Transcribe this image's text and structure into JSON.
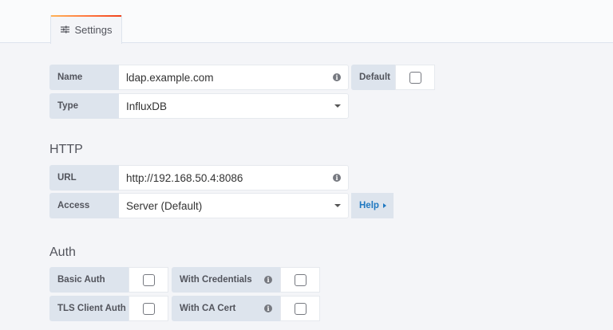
{
  "tabs": [
    {
      "label": "Settings",
      "icon": "sliders-icon",
      "active": true
    }
  ],
  "name": {
    "label": "Name",
    "value": "ldap.example.com"
  },
  "default": {
    "label": "Default",
    "checked": false
  },
  "type": {
    "label": "Type",
    "value": "InfluxDB"
  },
  "http": {
    "heading": "HTTP",
    "url": {
      "label": "URL",
      "value": "http://192.168.50.4:8086"
    },
    "access": {
      "label": "Access",
      "value": "Server (Default)"
    },
    "help_label": "Help"
  },
  "auth": {
    "heading": "Auth",
    "basic_auth": {
      "label": "Basic Auth",
      "checked": false
    },
    "with_credentials": {
      "label": "With Credentials",
      "checked": false
    },
    "tls_client_auth": {
      "label": "TLS Client Auth",
      "checked": false
    },
    "with_ca_cert": {
      "label": "With CA Cert",
      "checked": false
    }
  },
  "info_glyph": "i"
}
